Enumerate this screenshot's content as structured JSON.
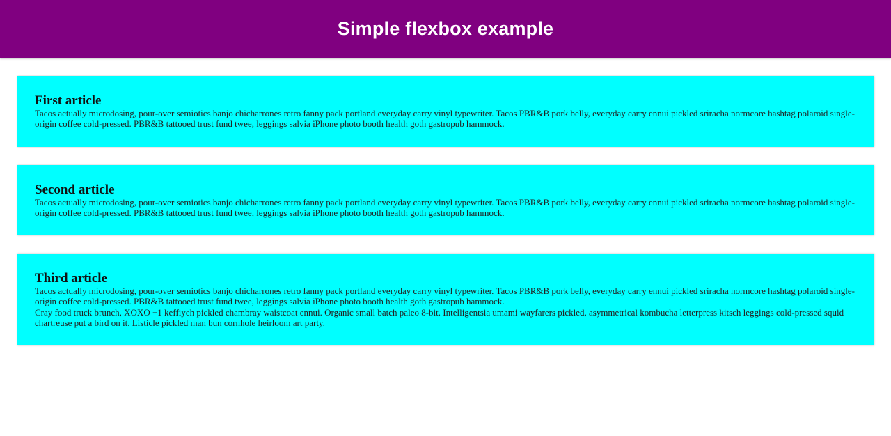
{
  "header": {
    "title": "Simple flexbox example"
  },
  "colors": {
    "header_bg": "#800080",
    "header_text": "#ffffff",
    "article_bg": "#00ffff"
  },
  "articles": [
    {
      "title": "First article",
      "paragraphs": [
        "Tacos actually microdosing, pour-over semiotics banjo chicharrones retro fanny pack portland everyday carry vinyl typewriter. Tacos PBR&B pork belly, everyday carry ennui pickled sriracha normcore hashtag polaroid single-origin coffee cold-pressed. PBR&B tattooed trust fund twee, leggings salvia iPhone photo booth health goth gastropub hammock."
      ]
    },
    {
      "title": "Second article",
      "paragraphs": [
        "Tacos actually microdosing, pour-over semiotics banjo chicharrones retro fanny pack portland everyday carry vinyl typewriter. Tacos PBR&B pork belly, everyday carry ennui pickled sriracha normcore hashtag polaroid single-origin coffee cold-pressed. PBR&B tattooed trust fund twee, leggings salvia iPhone photo booth health goth gastropub hammock."
      ]
    },
    {
      "title": "Third article",
      "paragraphs": [
        "Tacos actually microdosing, pour-over semiotics banjo chicharrones retro fanny pack portland everyday carry vinyl typewriter. Tacos PBR&B pork belly, everyday carry ennui pickled sriracha normcore hashtag polaroid single-origin coffee cold-pressed. PBR&B tattooed trust fund twee, leggings salvia iPhone photo booth health goth gastropub hammock.",
        "Cray food truck brunch, XOXO +1 keffiyeh pickled chambray waistcoat ennui. Organic small batch paleo 8-bit. Intelligentsia umami wayfarers pickled, asymmetrical kombucha letterpress kitsch leggings cold-pressed squid chartreuse put a bird on it. Listicle pickled man bun cornhole heirloom art party."
      ]
    }
  ]
}
